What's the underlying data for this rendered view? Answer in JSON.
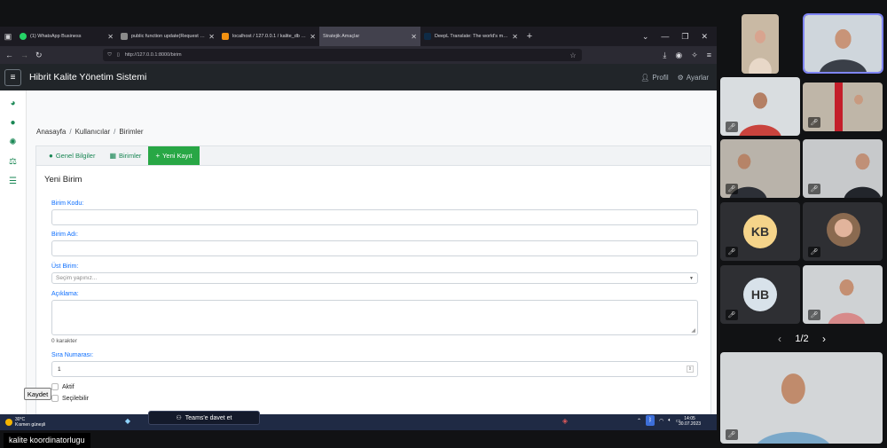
{
  "browser": {
    "tabs": [
      {
        "title": "(1) WhatsApp Business",
        "color": "#25d366",
        "active": false
      },
      {
        "title": "public function update(Request $req...",
        "color": "#8a8a8a",
        "active": false
      },
      {
        "title": "localhost / 127.0.0.1 / kalite_db / kalit...",
        "color": "#f29111",
        "active": false
      },
      {
        "title": "Stratejik Amaçlar",
        "color": "#6c757d",
        "active": true
      },
      {
        "title": "DeepL Translate: The world's most acc...",
        "color": "#0f2b46",
        "active": false
      }
    ],
    "url": "http://127.0.0.1:8000/birim"
  },
  "app": {
    "brand": "Hibrit Kalite Yönetim Sistemi",
    "nav": {
      "profile": "Profil",
      "settings": "Ayarlar"
    }
  },
  "breadcrumb": [
    "Anasayfa",
    "Kullanıcılar",
    "Birimler"
  ],
  "tabs": [
    {
      "label": "Genel Bilgiler",
      "icon": "info-circle-icon",
      "active": false
    },
    {
      "label": "Birimler",
      "icon": "table-icon",
      "active": false
    },
    {
      "label": "Yeni Kayıt",
      "icon": "plus-icon",
      "active": true
    }
  ],
  "form": {
    "title": "Yeni Birim",
    "code_label": "Birim Kodu:",
    "name_label": "Birim Adı:",
    "parent_label": "Üst Birim:",
    "parent_placeholder": "Seçim yapınız...",
    "desc_label": "Açıklama:",
    "char_count": "0 karakter",
    "order_label": "Sıra Numarası:",
    "order_value": "1",
    "active_label": "Aktif",
    "selectable_label": "Seçilebilir",
    "save_label": "Kaydet"
  },
  "taskbar": {
    "temp": "30°C",
    "weather": "Kısmen güneşli",
    "teams_label": "Teams'e davet et",
    "time": "14:05",
    "date": "30.07.2023"
  },
  "caption": "kalite koordinatorlugu",
  "participants": {
    "initials_1": "KB",
    "initials_2": "HB",
    "pager": "1/2"
  },
  "colors": {
    "accent": "#28a745",
    "navbar": "#212529",
    "link": "#0d6efd"
  }
}
